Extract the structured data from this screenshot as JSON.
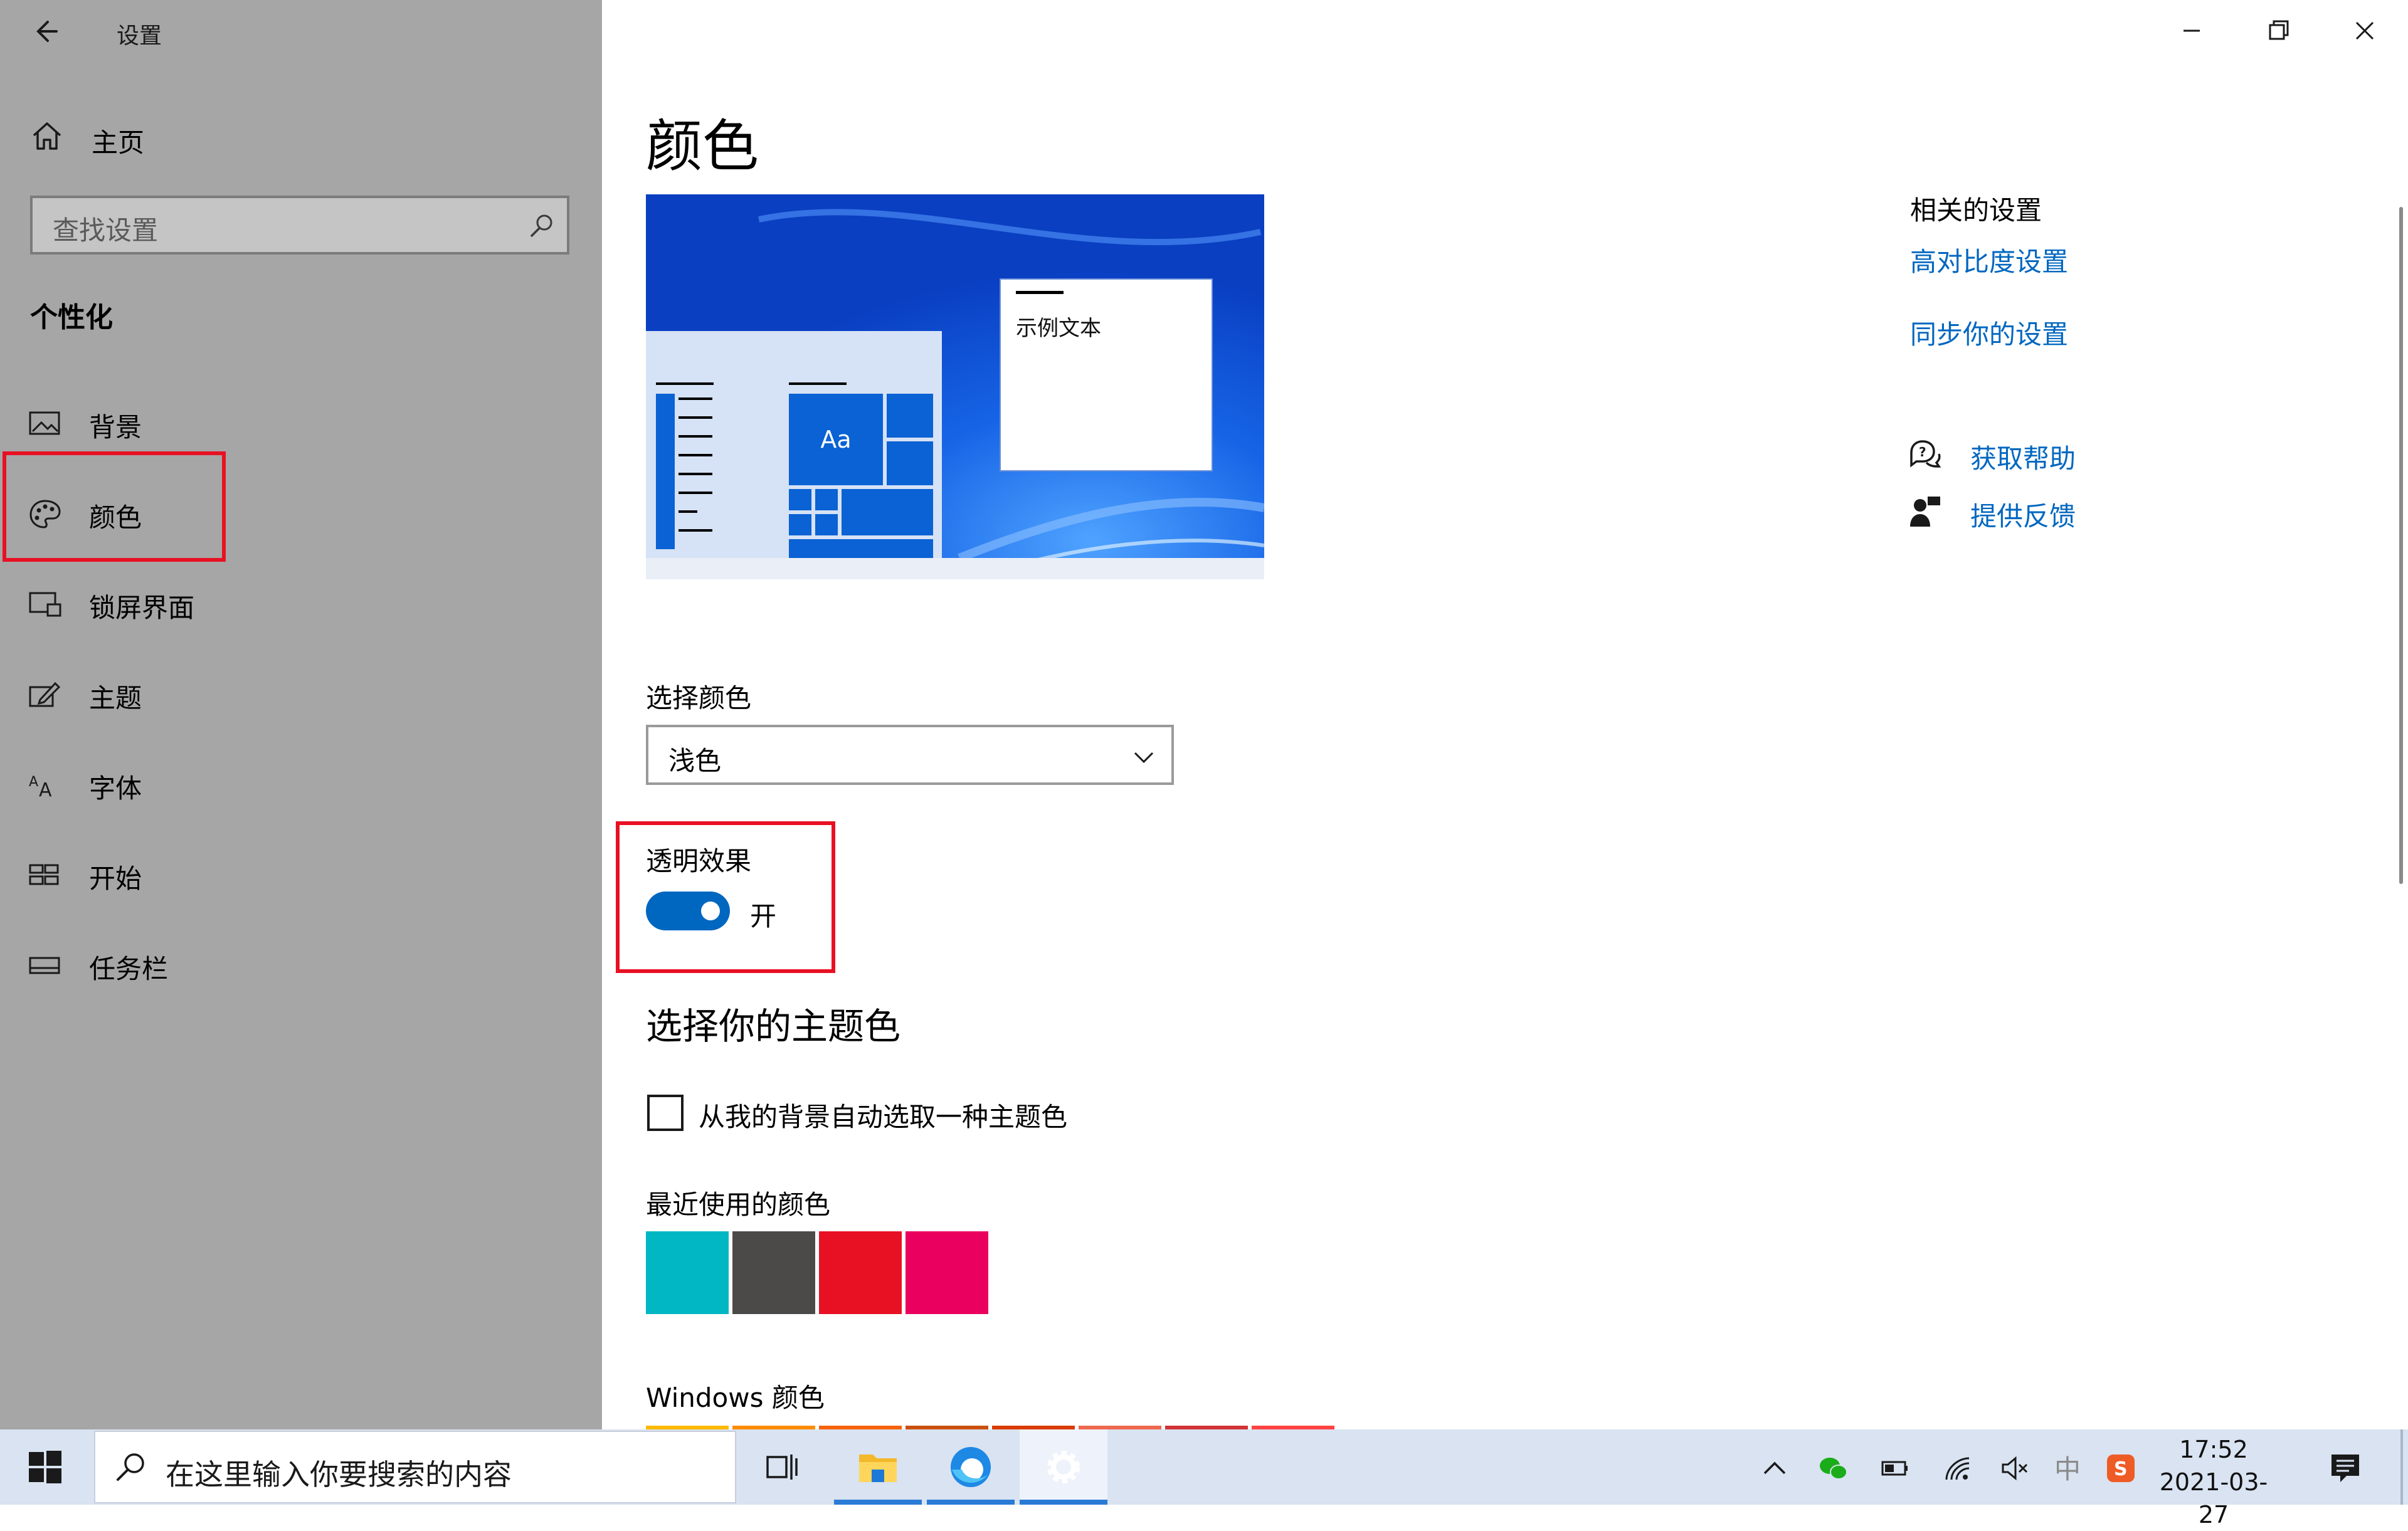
{
  "window": {
    "title": "设置"
  },
  "sidebar": {
    "home_label": "主页",
    "search_placeholder": "查找设置",
    "section_title": "个性化",
    "items": [
      {
        "label": "背景",
        "icon": "picture-icon"
      },
      {
        "label": "颜色",
        "icon": "palette-icon",
        "selected": true
      },
      {
        "label": "锁屏界面",
        "icon": "lockscreen-icon"
      },
      {
        "label": "主题",
        "icon": "theme-icon"
      },
      {
        "label": "字体",
        "icon": "font-icon"
      },
      {
        "label": "开始",
        "icon": "start-icon"
      },
      {
        "label": "任务栏",
        "icon": "taskbar-icon"
      }
    ]
  },
  "main": {
    "title": "颜色",
    "preview": {
      "sample_text": "示例文本",
      "tile_text": "Aa"
    },
    "choose_color_label": "选择颜色",
    "choose_color_value": "浅色",
    "transparency_label": "透明效果",
    "transparency_state": "开",
    "accent_title": "选择你的主题色",
    "auto_accent_label": "从我的背景自动选取一种主题色",
    "recent_colors_label": "最近使用的颜色",
    "recent_colors": [
      "#00b7c3",
      "#4c4a48",
      "#e81123",
      "#ea005e"
    ],
    "windows_colors_label": "Windows 颜色",
    "windows_colors": [
      "#ffb900",
      "#ff8c00",
      "#f7630c",
      "#ca5010",
      "#da3b01",
      "#ef6950",
      "#d13438",
      "#ff4343"
    ]
  },
  "related": {
    "title": "相关的设置",
    "links": [
      "高对比度设置",
      "同步你的设置"
    ],
    "help_label": "获取帮助",
    "feedback_label": "提供反馈"
  },
  "taskbar": {
    "search_placeholder": "在这里输入你要搜索的内容",
    "time": "17:52",
    "date": "2021-03-27",
    "ime": "中"
  },
  "colors": {
    "accent": "#0067c0",
    "highlight": "#e81123"
  }
}
